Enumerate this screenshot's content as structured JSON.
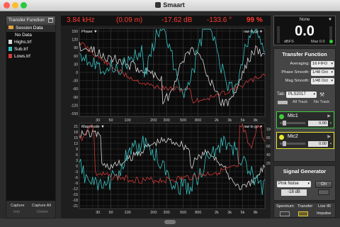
{
  "window": {
    "title": "Smaart"
  },
  "left_panel": {
    "header": "Transfer Function",
    "items": [
      {
        "label": "Session Data",
        "icon": "folder-icon"
      },
      {
        "label": "No Data",
        "icon": ""
      },
      {
        "label": "Highs.trf",
        "icon": "document-icon",
        "color": "#d9d9d9"
      },
      {
        "label": "Sub.trf",
        "icon": "document-icon",
        "color": "#39c3c3"
      },
      {
        "label": "Lows.trf",
        "icon": "document-icon",
        "color": "#d23a3a"
      }
    ],
    "footer": {
      "capture": "Capture",
      "capture_all": "Capture All",
      "info": "Info",
      "delete": "Delete"
    }
  },
  "readout": {
    "frequency": "3.84 kHz",
    "time": "(0.09 m)",
    "magnitude": "-17.62 dB",
    "phase": "-133.6 °",
    "coherence": "99 %"
  },
  "phase_plot": {
    "label": "Phase",
    "mode": "raw to gp",
    "y_ticks": [
      "150",
      "120",
      "90",
      "60",
      "30",
      "0",
      "-30",
      "-60",
      "-90",
      "-120",
      "-150"
    ],
    "x_ticks": [
      "30",
      "50",
      "100",
      "200",
      "300",
      "500",
      "800",
      "2k",
      "3k",
      "5k",
      "8k"
    ]
  },
  "magnitude_plot": {
    "label": "Magnitude",
    "mode": "raw to gp",
    "y_ticks": [
      "21",
      "18",
      "15",
      "12",
      "9",
      "6",
      "3",
      "0",
      "-3",
      "-6",
      "-9",
      "-12",
      "-15",
      "-18",
      "-21"
    ],
    "y_right_ticks": [
      "100",
      "80",
      "60",
      "40",
      "20"
    ],
    "x_ticks": [
      "30",
      "50",
      "100",
      "200",
      "300",
      "500",
      "800",
      "2k",
      "3k",
      "5k",
      "8k"
    ]
  },
  "meter": {
    "source": "None",
    "value": "0.0",
    "unit": "dBFS",
    "max_label": "Max",
    "max_value": "0.0"
  },
  "transfer_function": {
    "title": "Transfer Function",
    "averaging": {
      "label": "Averaging:",
      "value": "16 FIFO"
    },
    "phase_smooth": {
      "label": "Phase Smooth:",
      "value": "1/48 Oct"
    },
    "mag_smooth": {
      "label": "Mag Smooth:",
      "value": "1/48 Oct"
    },
    "tab": {
      "label": "Tab:",
      "value": "PLS2017"
    },
    "all_track": "All Track",
    "no_track": "No Track"
  },
  "mics": [
    {
      "name": "Mic1",
      "value": "0.00",
      "color": "#3ecb3e"
    },
    {
      "name": "Mic2",
      "value": "0.00",
      "color": "#e8e82e"
    }
  ],
  "signal_generator": {
    "title": "Signal Generator",
    "type": "Pink Noise",
    "level": "-18 dB",
    "on_label": "On"
  },
  "bottom_tabs": {
    "spectrum": "Spectrum",
    "transfer": "Transfer",
    "live_ir": "Live IR",
    "impulse": "Impulse"
  },
  "colors": {
    "trace_white": "#d9d9d9",
    "trace_cyan": "#39c3c3",
    "trace_red": "#d23a3a",
    "readout_red": "#ff3b30",
    "grid": "#4a4a4a"
  }
}
